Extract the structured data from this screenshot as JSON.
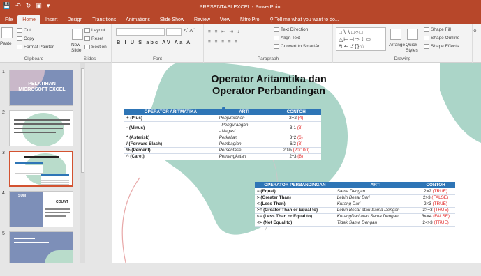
{
  "window": {
    "title": "PRESENTASI EXCEL - PowerPoint"
  },
  "tabs": [
    "File",
    "Home",
    "Insert",
    "Design",
    "Transitions",
    "Animations",
    "Slide Show",
    "Review",
    "View",
    "Nitro Pro"
  ],
  "tell_me": "Tell me what you want to do...",
  "ribbon": {
    "paste": "Paste",
    "cut": "Cut",
    "copy": "Copy",
    "format_painter": "Format Painter",
    "clipboard": "Clipboard",
    "new_slide": "New Slide",
    "layout": "Layout",
    "reset": "Reset",
    "section": "Section",
    "slides": "Slides",
    "font": "Font",
    "paragraph": "Paragraph",
    "text_direction": "Text Direction",
    "align_text": "Align Text",
    "convert_smartart": "Convert to SmartArt",
    "arrange": "Arrange",
    "quick_styles": "Quick Styles",
    "shape_fill": "Shape Fill",
    "shape_outline": "Shape Outline",
    "shape_effects": "Shape Effects",
    "drawing": "Drawing"
  },
  "thumbnails": [
    {
      "num": "1",
      "text": "PELATIHAN MICROSOFT EXCEL"
    },
    {
      "num": "2",
      "text": ""
    },
    {
      "num": "3",
      "text": ""
    },
    {
      "num": "4",
      "text": "SUM",
      "text2": "COUNT"
    },
    {
      "num": "5",
      "text": ""
    }
  ],
  "slide": {
    "title": "Operator Aritamtika dan Operator Perbandingan",
    "arith": {
      "headers": [
        "OPERATOR ARITMATIKA",
        "ARTI",
        "CONTOH"
      ],
      "rows": [
        {
          "op": "+ (Plus)",
          "meaning": "Penjumlahan",
          "ex": "2+2 ",
          "res": "(4)"
        },
        {
          "op": "- (Minus)",
          "meaning": "- Pengurangan",
          "meaning2": "- Negasi",
          "ex": "3-1 ",
          "res": "(3)"
        },
        {
          "op": "* (Asterisk)",
          "meaning": "Perkalian",
          "ex": "3*2 ",
          "res": "(6)"
        },
        {
          "op": "/ (Forward Slash)",
          "meaning": "Pembagian",
          "ex": "6/2 ",
          "res": "(3)"
        },
        {
          "op": "% (Percent)",
          "meaning": "Persentase",
          "ex": "20% ",
          "res": "(20/100)"
        },
        {
          "op": "^ (Caret)",
          "meaning": "Pemangkatan",
          "ex": "2^3 ",
          "res": "(8)"
        }
      ]
    },
    "comp": {
      "headers": [
        "OPERATOR PERBANDINGAN",
        "ARTI",
        "CONTOH"
      ],
      "rows": [
        {
          "op": "= (Equal)",
          "meaning": "Sama Dengan",
          "ex": "2=2 ",
          "res": "(TRUE)"
        },
        {
          "op": "> (Greater Than)",
          "meaning": "Lebih Besar Dari",
          "ex": "2>3 ",
          "res": "(FALSE)"
        },
        {
          "op": "< (Less Than)",
          "meaning": "Kurang Dari",
          "ex": "2<3 ",
          "res": "(TRUE)"
        },
        {
          "op": ">= (Greater Than or Equal to)",
          "meaning": "Lebih Besar atau Sama Dengan",
          "ex": "3>=3 ",
          "res": "(TRUE)"
        },
        {
          "op": "<= (Less Than or Equal to)",
          "meaning": "KurangDari atau Sama Dengan",
          "ex": "3<=4 ",
          "res": "(FALSE)"
        },
        {
          "op": "<> (Not Equal to)",
          "meaning": "Tidak Sama Dengan",
          "ex": "2<>3 ",
          "res": "(TRUE)"
        }
      ]
    }
  },
  "colors": {
    "accent": "#b7472a",
    "table_header": "#2e75b6",
    "blob": "#8fc7b5",
    "result": "#e02020"
  }
}
